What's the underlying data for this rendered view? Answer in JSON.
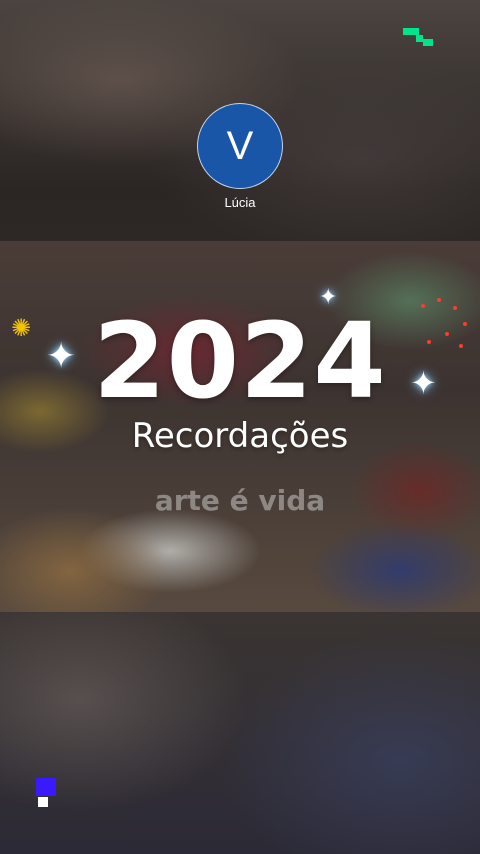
{
  "profile": {
    "avatar_letter": "V",
    "avatar_color": "#1a56a8",
    "username": "Lúcia"
  },
  "media": {
    "year": "2024",
    "title": "Recordações",
    "subtitle": "arte é vida"
  },
  "decor": {
    "sparkle_glyph": "✦",
    "flower_glyph": "✺",
    "icons": [
      "sparkle-icon",
      "flower-icon",
      "red-dots-decoration"
    ]
  },
  "branding": {
    "top_logo_color": "#00e58a",
    "bottom_logo_color": "#3b19ff"
  }
}
